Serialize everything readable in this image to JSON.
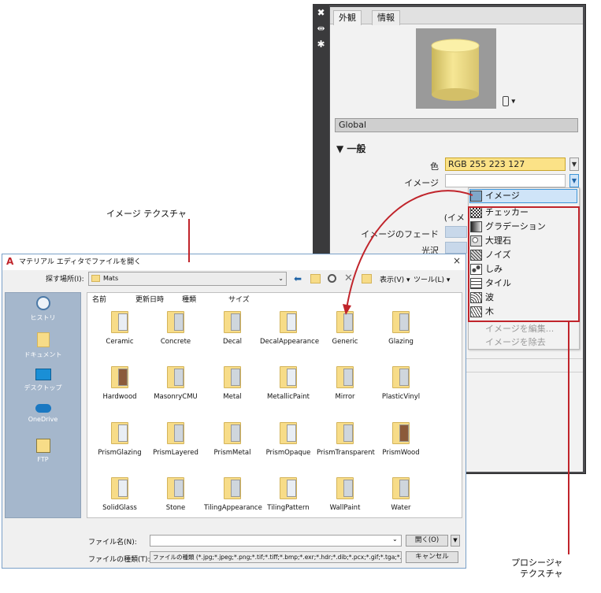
{
  "material_editor": {
    "tabs": [
      "外観",
      "情報"
    ],
    "global_label": "Global",
    "section_general": "▼ 一般",
    "labels": {
      "color": "色",
      "image": "イメージ",
      "image_paren": "(イメ",
      "image_fade": "イメージのフェード",
      "gloss": "光沢"
    },
    "color_value": "RGB 255 223 127",
    "preview_menu": "▾",
    "dropdown": {
      "selected": "イメージ",
      "procedural_items": [
        "チェッカー",
        "グラデーション",
        "大理石",
        "ノイズ",
        "しみ",
        "タイル",
        "波",
        "木"
      ],
      "disabled_items": [
        "イメージを編集...",
        "イメージを除去"
      ]
    }
  },
  "callouts": {
    "image_texture": "イメージ テクスチャ",
    "procedural_texture_line1": "プロシージャ",
    "procedural_texture_line2": "テクスチャ"
  },
  "file_dialog": {
    "title": "マテリアル エディタでファイルを開く",
    "close_icon": "×",
    "look_in_label": "探す場所(I):",
    "look_in_value": "Mats",
    "view_menu": "表示(V)",
    "tools_menu": "ツール(L)",
    "places": [
      "ヒストリ",
      "ドキュメント",
      "デスクトップ",
      "OneDrive",
      "FTP"
    ],
    "columns": [
      "名前",
      "更新日時",
      "種類",
      "サイズ"
    ],
    "files": [
      "Ceramic",
      "Concrete",
      "Decal",
      "DecalAppearance",
      "Generic",
      "Glazing",
      "Hardwood",
      "MasonryCMU",
      "Metal",
      "MetallicPaint",
      "Mirror",
      "PlasticVinyl",
      "PrismGlazing",
      "PrismLayered",
      "PrismMetal",
      "PrismOpaque",
      "PrismTransparent",
      "PrismWood",
      "SolidGlass",
      "Stone",
      "TilingAppearance",
      "TilingPattern",
      "WallPaint",
      "Water"
    ],
    "filename_label": "ファイル名(N):",
    "filename_value": "",
    "filetype_label": "ファイルの種類(T):",
    "filetype_value": "ファイルの種類 (*.jpg;*.jpeg;*.png;*.tif;*.tiff;*.bmp;*.exr;*.hdr;*.dib;*.pcx;*.gif;*.tga;*.rle)",
    "open_button": "開く(O)",
    "cancel_button": "キャンセル"
  }
}
